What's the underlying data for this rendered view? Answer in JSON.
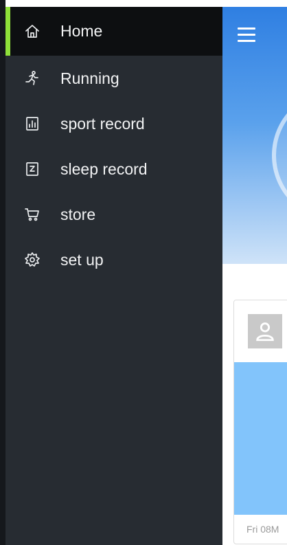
{
  "drawer": {
    "items": [
      {
        "label": "Home",
        "icon": "home-icon"
      },
      {
        "label": "Running",
        "icon": "running-icon"
      },
      {
        "label": "sport record",
        "icon": "sport-record-icon"
      },
      {
        "label": "sleep record",
        "icon": "sleep-record-icon"
      },
      {
        "label": "store",
        "icon": "cart-icon"
      },
      {
        "label": "set up",
        "icon": "gear-icon"
      }
    ],
    "active_index": 0,
    "colors": {
      "background": "#272c32",
      "active_background": "#0d0f11",
      "accent": "#8fe03a"
    }
  },
  "main": {
    "menu_icon": "hamburger-icon",
    "card": {
      "avatar_icon": "user-icon",
      "footer_text": "Fri 08M"
    },
    "colors": {
      "hero": "#2f7fe2",
      "card_body": "#82c4fb"
    }
  }
}
